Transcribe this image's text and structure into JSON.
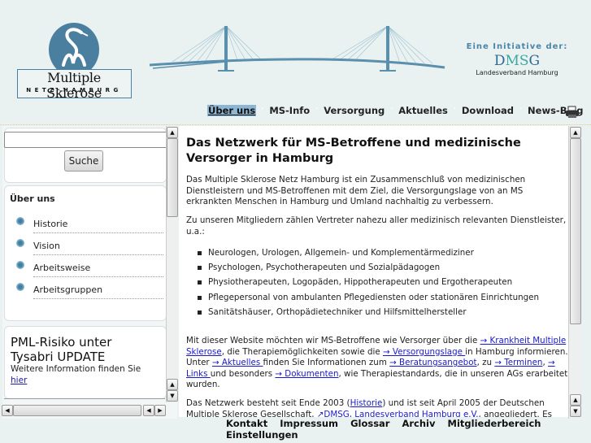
{
  "header": {
    "logo": {
      "title": "Multiple Sklerose",
      "subtitle": "NETZ·HAMBURG"
    },
    "initiative": {
      "label": "Eine Initiative der:",
      "org_prefix": "D",
      "org_ms": "MS",
      "org_suffix": "G",
      "region": "Landesverband Hamburg"
    }
  },
  "nav": {
    "items": [
      {
        "label": "Über uns",
        "active": true
      },
      {
        "label": "MS-Info"
      },
      {
        "label": "Versorgung"
      },
      {
        "label": "Aktuelles"
      },
      {
        "label": "Download"
      },
      {
        "label": "News-Blog"
      }
    ],
    "print_icon": "printer-icon"
  },
  "sidebar": {
    "search": {
      "value": "",
      "button": "Suche"
    },
    "menu_title": "Über uns",
    "menu_items": [
      "Historie",
      "Vision",
      "Arbeitsweise",
      "Arbeitsgruppen"
    ],
    "news": {
      "title": "PML-Risiko unter Tysabri UPDATE",
      "text": "Weitere Information finden Sie",
      "link": "hier"
    }
  },
  "content": {
    "title": "Das Netzwerk für MS-Betroffene und medizinische Versorger in Hamburg",
    "p1": "Das Multiple Sklerose Netz Hamburg ist ein Zusammenschluß von medizinischen Dienstleistern und MS-Betroffenen mit dem Ziel, die Versorgungslage von an MS erkrankten Menschen in Hamburg und Umland nachhaltig zu verbessern.",
    "p2": "Zu unseren Mitgliedern zählen Vertreter nahezu aller medizinisch relevanten Dienstleister, u.a.:",
    "list": [
      "Neurologen, Urologen, Allgemein- und Komplementärmediziner",
      "Psychologen, Psychotherapeuten und Sozialpädagogen",
      "Physiotherapeuten, Logopäden, Hippotherapeuten und Ergotherapeuten",
      "Pflegepersonal von ambulanten Pflegediensten oder stationären Einrichtungen",
      "Sanitätshäuser, Orthopädietechniker und Hilfsmittelhersteller"
    ],
    "p3": {
      "t1": "Mit dieser Website möchten wir MS-Betroffene wie Versorger über die ",
      "l1": "→ Krankheit Multiple Sklerose",
      "t2": ", die Therapiemöglichkeiten sowie die ",
      "l2": "→ Versorgungslage ",
      "t3": "in Hamburg informieren. Unter ",
      "l3": "→ Aktuelles ",
      "t4": "finden Sie Informationen zum ",
      "l4": "→ Beratungsangebot",
      "t5": ", zu ",
      "l5": "→ Terminen",
      "t6": ", ",
      "l6": "→ Links ",
      "t7": "und besonders ",
      "l7": "→ Dokumenten",
      "t8": ", wie Therapiestandards, die in unseren AGs erarbeitet wurden."
    },
    "p4": {
      "t1": "Das Netzwerk besteht seit Ende 2003 (",
      "l1": "Historie",
      "t2": ") und ist seit April 2005 der Deutschen Multiple Sklerose Gesellschaft, ",
      "l2": "↗DMSG, Landesverband Hamburg e.V.",
      "t3": ", angegliedert. Es"
    }
  },
  "footer": {
    "items": [
      "Kontakt",
      "Impressum",
      "Glossar",
      "Archiv",
      "Mitgliederbereich",
      "Einstellungen"
    ]
  }
}
